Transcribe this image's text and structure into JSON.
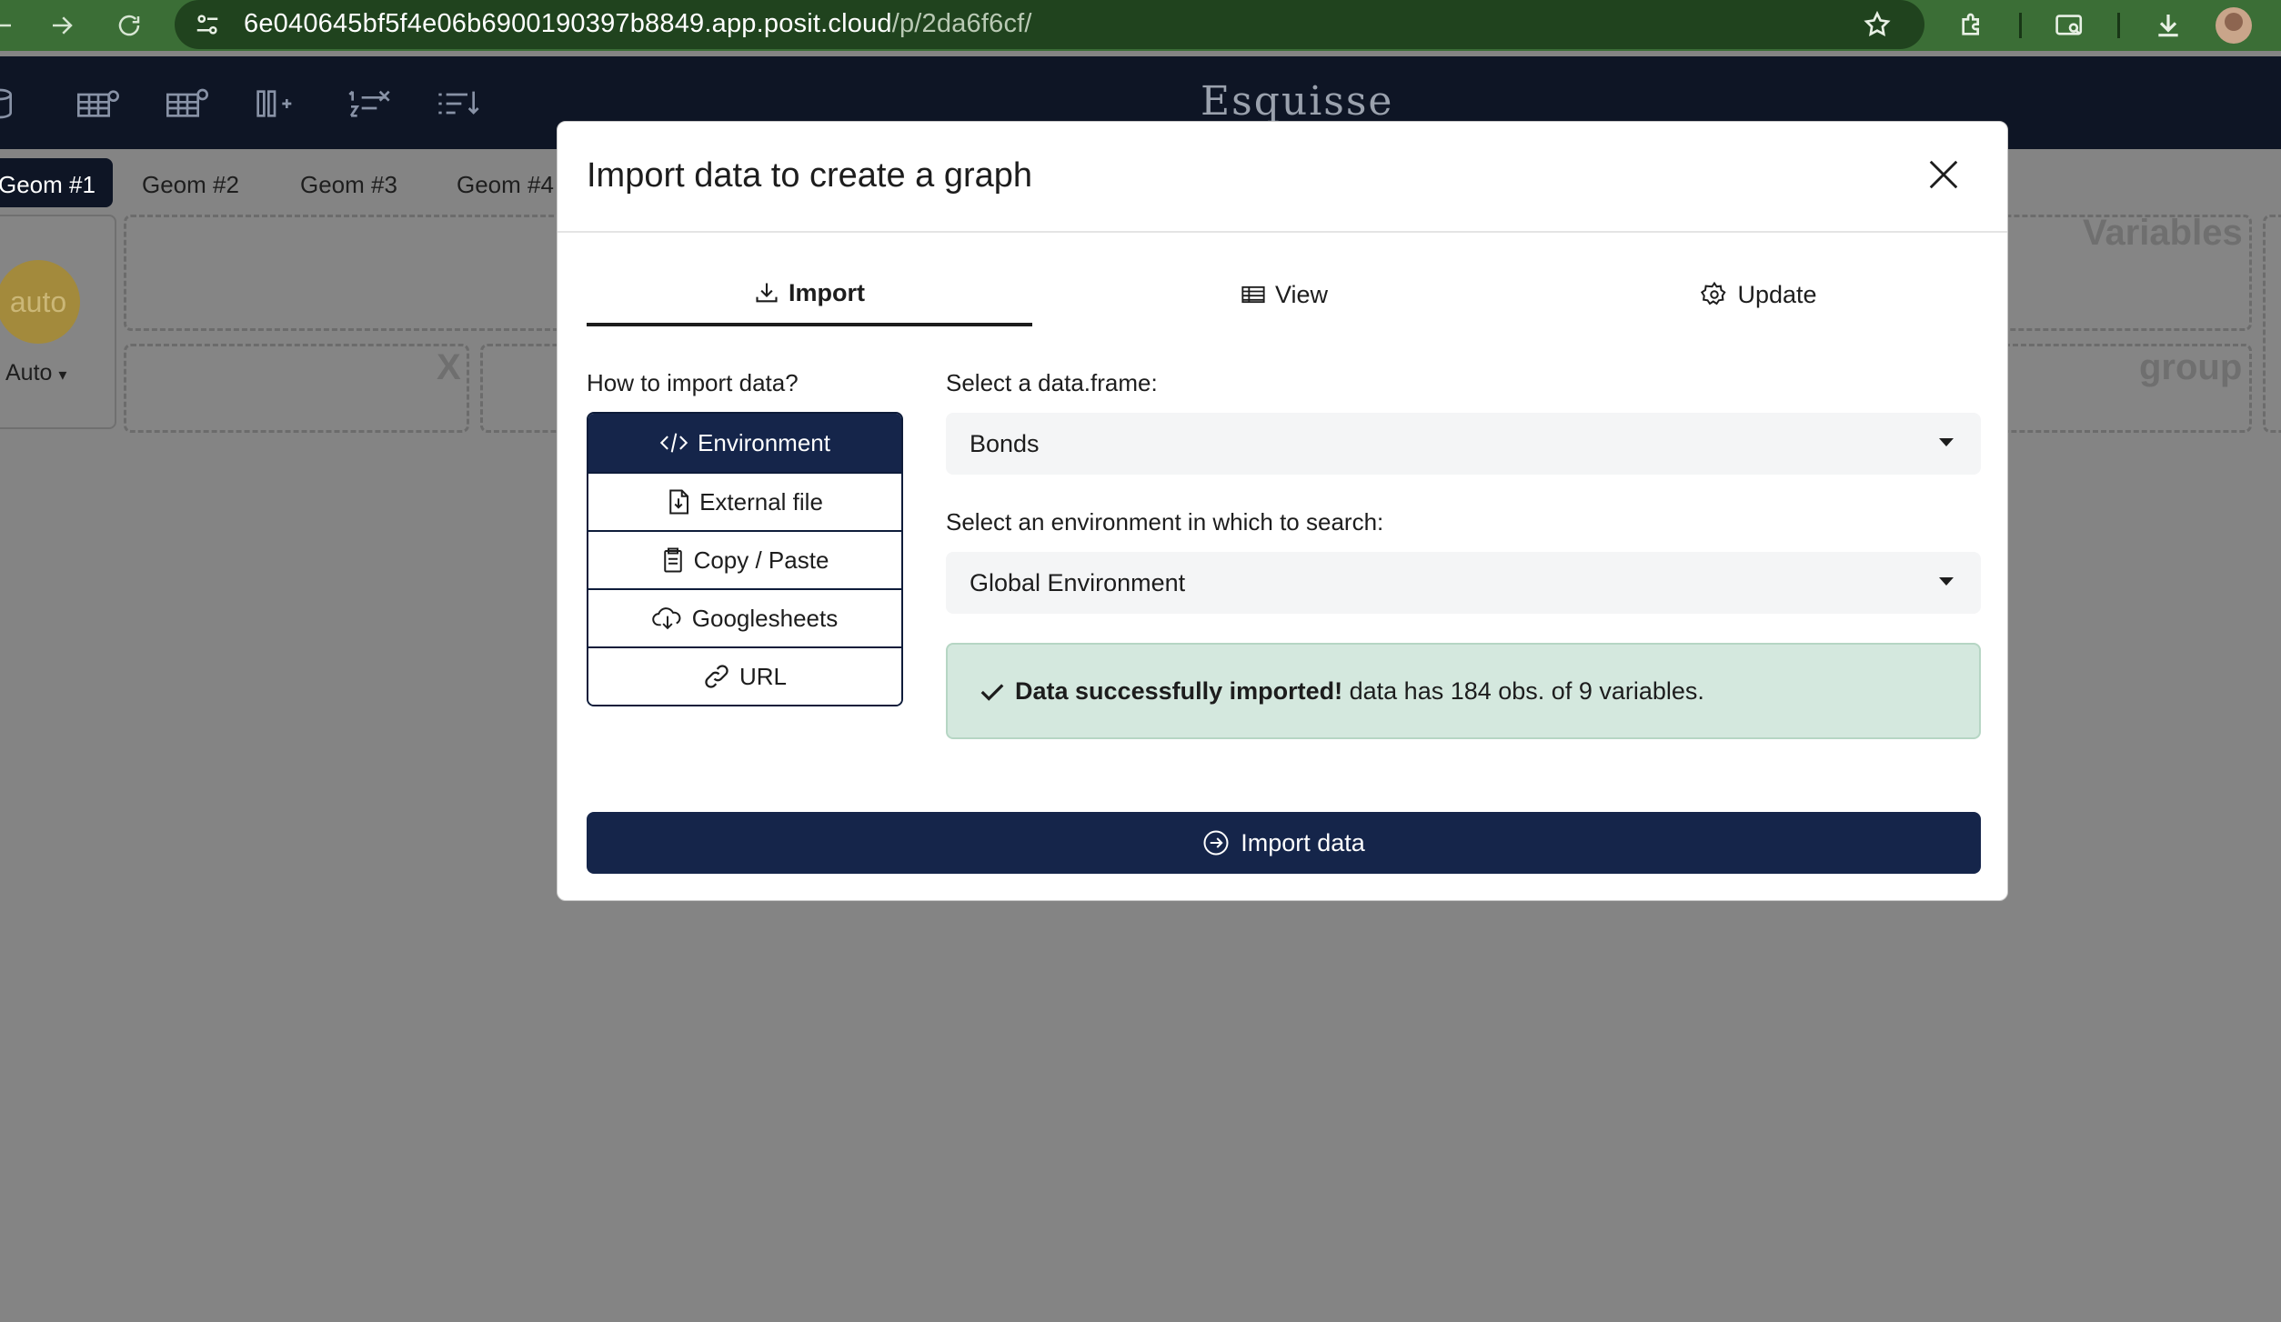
{
  "browser": {
    "url_host": "6e040645bf5f4e06b6900190397b8849.app.posit.cloud",
    "url_path": "/p/2da6f6cf/"
  },
  "app": {
    "title": "Esquisse",
    "geom_tabs": [
      "Geom #1",
      "Geom #2",
      "Geom #3",
      "Geom #4"
    ],
    "auto_circle": "auto",
    "auto_dropdown": "Auto",
    "dropzones": {
      "x": "X",
      "variables": "Variables",
      "group": "group"
    }
  },
  "modal": {
    "title": "Import data to create a graph",
    "tabs": [
      {
        "label": "Import",
        "icon": "download-icon",
        "active": true
      },
      {
        "label": "View",
        "icon": "table-icon",
        "active": false
      },
      {
        "label": "Update",
        "icon": "gear-icon",
        "active": false
      }
    ],
    "how_label": "How to import data?",
    "methods": [
      {
        "label": "Environment",
        "icon": "code-icon",
        "active": true
      },
      {
        "label": "External file",
        "icon": "file-import-icon",
        "active": false
      },
      {
        "label": "Copy / Paste",
        "icon": "clipboard-icon",
        "active": false
      },
      {
        "label": "Googlesheets",
        "icon": "cloud-download-icon",
        "active": false
      },
      {
        "label": "URL",
        "icon": "link-icon",
        "active": false
      }
    ],
    "dataframe_label": "Select a data.frame:",
    "dataframe_value": "Bonds",
    "env_label": "Select an environment in which to search:",
    "env_value": "Global Environment",
    "alert_bold": "Data successfully imported!",
    "alert_text": " data has 184 obs. of 9 variables.",
    "import_button": "Import data"
  },
  "colors": {
    "browser_green": "#3b6e36",
    "navy": "#15254a",
    "success_bg": "#d4e8de"
  }
}
